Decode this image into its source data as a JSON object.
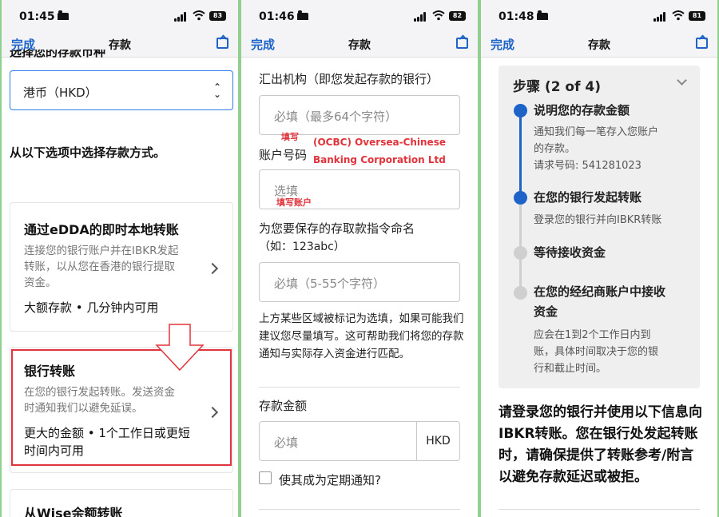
{
  "common": {
    "done_label": "完成",
    "nav_title": "存款"
  },
  "panel1": {
    "status": {
      "time": "01:45",
      "battery": "83"
    },
    "clipped_text": "选择您的存款币种",
    "currency_select": "港币（HKD）",
    "choose_method": "从以下选项中选择存款方式。",
    "cards": [
      {
        "title": "通过eDDA的即时本地转账",
        "desc": "连接您的银行账户并在IBKR发起转账，以从您在香港的银行提取资金。",
        "foot": "大额存款 • 几分钟内可用"
      },
      {
        "title": "银行转账",
        "desc": "在您的银行发起转账。发送资金时通知我们以避免延误。",
        "foot": "更大的金额 • 1个工作日或更短时间内可用"
      },
      {
        "title": "从Wise余额转账"
      }
    ]
  },
  "panel2": {
    "status": {
      "time": "01:46",
      "battery": "82"
    },
    "remit_label": "汇出机构（即您发起存款的银行）",
    "remit_placeholder": "必填（最多64个字符）",
    "annotation_fill": "填写",
    "annotation_bank_line1": "(OCBC) Oversea-Chinese",
    "annotation_bank_line2": "Banking Corporation Ltd",
    "account_label": "账户号码",
    "account_placeholder": "选填",
    "annotation_account": "填写账户",
    "name_label_line1": "为您要保存的存取款指令命名",
    "name_label_line2": "（如：123abc）",
    "name_placeholder": "必填（5-55个字符）",
    "info_para": "上方某些区域被标记为选填，如果可能我们建议您尽量填写。这可帮助我们将您的存款通知与实际存入资金进行匹配。",
    "amount_label": "存款金额",
    "amount_placeholder": "必填",
    "amount_currency": "HKD",
    "recurring_label": "使其成为定期通知?"
  },
  "panel3": {
    "status": {
      "time": "01:48",
      "battery": "81"
    },
    "steps_title": "步骤 (2 of 4)",
    "steps": [
      {
        "title": "说明您的存款金额",
        "desc_lines": [
          "通知我们每一笔存入您账户",
          "的存款。",
          "请求号码: 541281023"
        ],
        "state": "done"
      },
      {
        "title": "在您的银行发起转账",
        "desc_lines": [
          "登录您的银行并向IBKR转账"
        ],
        "state": "current"
      },
      {
        "title": "等待接收资金",
        "state": "pending"
      },
      {
        "title_lines": [
          "在您的经纪商账户中接收",
          "资金"
        ],
        "desc_lines": [
          "应会在1到2个工作日内到",
          "账，具体时间取决于您的银",
          "行和截止时间。"
        ],
        "state": "pending"
      }
    ],
    "instruction": "请登录您的银行并使用以下信息向IBKR转账。您在银行处发起转账时，请确保提供了转账参考/附言以避免存款延迟或被拒。"
  },
  "colors": {
    "accent": "#1e64c8",
    "step_active": "#1e64c8",
    "step_pending": "#cfcfcf",
    "annotation": "#e0333b",
    "frame": "#8fd08f"
  }
}
